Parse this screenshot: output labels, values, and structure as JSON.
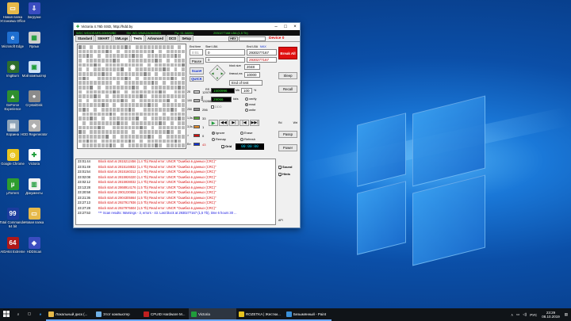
{
  "desktop_icons": [
    {
      "label": "Новая папка\nУстановка Office",
      "color": "#e6b94a",
      "glyph": "▭"
    },
    {
      "label": "Microsoft Edge",
      "color": "#1f6fd1",
      "glyph": "e"
    },
    {
      "label": "ImgBurn",
      "color": "#2e6e2e",
      "glyph": "◉"
    },
    {
      "label": "GeForce Experience",
      "color": "#2f8f2f",
      "glyph": "▲"
    },
    {
      "label": "Корзина",
      "color": "#8fa4b8",
      "glyph": "▤"
    },
    {
      "label": "Google Chrome",
      "color": "#e8c420",
      "glyph": "◎"
    },
    {
      "label": "µTorrent",
      "color": "#2e9d2e",
      "glyph": "µ"
    },
    {
      "label": "Total Commander 64 bit",
      "color": "#1b3c9e",
      "glyph": "99"
    },
    {
      "label": "AIDA64 Extreme",
      "color": "#b01818",
      "glyph": "64"
    },
    {
      "label": "Загрузки",
      "color": "#3a4cc0",
      "glyph": "⇩"
    },
    {
      "label": "Ярлык",
      "color": "#d0d0d0",
      "glyph": "▦"
    },
    {
      "label": "Мой компьютер",
      "color": "#cfe3f6",
      "glyph": "▣"
    },
    {
      "label": "CrystalDisk",
      "color": "#8b8b8b",
      "glyph": "●"
    },
    {
      "label": "HDD Regenerator",
      "color": "#b0b0b0",
      "glyph": "◆"
    },
    {
      "label": "Victoria",
      "color": "#ffffff",
      "glyph": "✚"
    },
    {
      "label": "Документы",
      "color": "#f2f2f2",
      "glyph": "▥"
    },
    {
      "label": "Новая папка",
      "color": "#e6b94a",
      "glyph": "▭"
    },
    {
      "label": "HDDScan",
      "color": "#3a4cc0",
      "glyph": "◈"
    }
  ],
  "window": {
    "title": "Victoria 4.76b SSD, http://hdd.by",
    "hdr_model": "WDC WD10EARS-00MVWB0",
    "hdr_serial": "SN: WD-WMAZA0843431",
    "hdr_fw": "Fw: 51.0AB51",
    "hdr_lba": "2930277168 LBA (1,5 Tb)",
    "tabs": [
      "Standard",
      "SMART",
      "SMLogs",
      "Tests",
      "Advanced",
      "DCO",
      "Setup"
    ],
    "active_tab": "Tests",
    "hex": "HEX",
    "device": "Device 0",
    "end_lba_label": "End time",
    "start_lba_label": "Start LBA",
    "end_lba_hdr": "End LBA",
    "start_val": "0",
    "end_val": "2930277167",
    "end_val2": "2930277167",
    "max": "MAX",
    "timer": "0:01",
    "pause": "Pause",
    "scan": "Scan",
    "quick": "QUICK",
    "block_size_label": "block size",
    "block_size": "2048",
    "timeout_label": "timeout,ms",
    "timeout": "10000",
    "end_of_test": "End of test",
    "legend": [
      {
        "c": "#c8c8c8",
        "n": "25",
        "v": "1297982"
      },
      {
        "c": "#b0b0b0",
        "n": "100",
        "v": "132880"
      },
      {
        "c": "#909090",
        "n": "250",
        "v": "256"
      },
      {
        "c": "#5aaa3a",
        "n": "1,0s",
        "v": "33"
      },
      {
        "c": "#e08a2a",
        "n": "3,0s",
        "v": "1"
      },
      {
        "c": "#d01010",
        "n": ">",
        "v": "0"
      },
      {
        "c": "#1030d0",
        "n": "Err",
        "v": "43"
      }
    ],
    "rs_label": "RS",
    "mbs": "1500996",
    "mbs_unit": "Mb",
    "pct": "100",
    "pct_unit": "%",
    "kbs": "29066",
    "kbs_unit": "kb/s",
    "speed_side": "Dbk",
    "verify": "verify",
    "read": "read",
    "write": "write",
    "ddd": "DDD",
    "ignore": "Ignore",
    "erase": "Erase",
    "remap": "Remap",
    "refresh": "Refresh",
    "grid_label": "Grid",
    "elapsed": "00:00:00",
    "break_all": "Break All",
    "sleep": "Sleep",
    "recall": "Recall",
    "passp": "Passp",
    "power": "Power",
    "rd": "Rd",
    "wrt": "Wrt",
    "sound": "Sound",
    "hints": "Hints",
    "api": "API",
    "log": [
      {
        "t": "23:01:44",
        "m": "Block start at 2815212456 (1,4 Tb) Read error: UNCR \"Ошибка в данных (CRC)\"",
        "ok": false
      },
      {
        "t": "23:01:49",
        "m": "Block start at 2815148832 (1,4 Tb) Read error: UNCR \"Ошибка в данных (CRC)\"",
        "ok": false
      },
      {
        "t": "23:01:54",
        "m": "Block start at 2815160312 (1,4 Tb) Read error: UNCR \"Ошибка в данных (CRC)\"",
        "ok": false
      },
      {
        "t": "23:02:08",
        "m": "Block start at 2815926320 (1,4 Tb) Read error: UNCR \"Ошибка в данных (CRC)\"",
        "ok": false
      },
      {
        "t": "23:02:12",
        "m": "Block start at 2815938032 (1,4 Tb) Read error: UNCR \"Ошибка в данных (CRC)\"",
        "ok": false
      },
      {
        "t": "23:13:28",
        "m": "Block start at 2868914176 (1,5 Tb) Read error: UNCR \"Ошибка в данных (CRC)\"",
        "ok": false
      },
      {
        "t": "23:20:58",
        "m": "Block start at 2901230656 (1,5 Tb) Read error: UNCR \"Ошибка в данных (CRC)\"",
        "ok": false
      },
      {
        "t": "23:21:36",
        "m": "Block start at 2904305664 (1,5 Tb) Read error: UNCR \"Ошибка в данных (CRC)\"",
        "ok": false
      },
      {
        "t": "23:27:13",
        "m": "Block start at 2927917936 (1,5 Tb) Read error: UNCR \"Ошибка в данных (CRC)\"",
        "ok": false
      },
      {
        "t": "23:27:28",
        "m": "Block start at 2927975504 (1,5 Tb) Read error: UNCR \"Ошибка в данных (CRC)\"",
        "ok": false
      },
      {
        "t": "23:27:53",
        "m": "*** Scan results: Warnings - 3, errors - 43. Last block at 2930277167 (1,5 Tb), time 6 hours 30 ...",
        "ok": true
      }
    ]
  },
  "taskbar": {
    "items": [
      {
        "label": "Локальный диск (...",
        "color": "#e6b94a",
        "state": "open"
      },
      {
        "label": "Этот компьютер",
        "color": "#6fb0e6",
        "state": "open"
      },
      {
        "label": "CPUID Hardware M...",
        "color": "#c02020",
        "state": "open"
      },
      {
        "label": "Victoria",
        "color": "#1f9d3a",
        "state": "act"
      },
      {
        "label": "ROZETKA | Жестки...",
        "color": "#e8c420",
        "state": "open"
      },
      {
        "label": "Безымянный - Paint",
        "color": "#3a8fd8",
        "state": "open"
      }
    ],
    "lang": "РУС",
    "time": "23:29",
    "date": "08.10.2019"
  }
}
